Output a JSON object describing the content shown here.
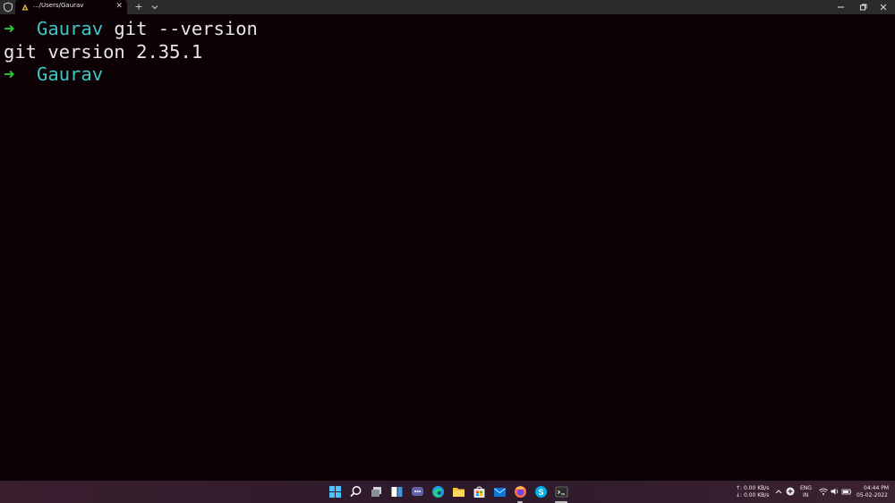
{
  "window": {
    "tab_title": ".../Users/Gaurav",
    "close_glyph": "✕",
    "new_tab_glyph": "+"
  },
  "terminal": {
    "lines": [
      {
        "arrow": "➜",
        "dir": "Gaurav",
        "cmd": " git --version"
      },
      {
        "output": "git version 2.35.1"
      },
      {
        "arrow": "➜",
        "dir": "Gaurav",
        "cmd": ""
      }
    ]
  },
  "taskbar": {
    "apps": [
      "windows-start",
      "search",
      "task-view",
      "widgets",
      "teams-chat",
      "edge",
      "file-explorer",
      "microsoft-store",
      "mail",
      "firefox",
      "skype",
      "terminal"
    ],
    "network_up": "↑: 0.00 KB/s",
    "network_down": "↓: 0.00 KB/s",
    "language_line1": "ENG",
    "language_line2": "IN",
    "time": "04:44 PM",
    "date": "05-02-2022"
  },
  "colors": {
    "terminal_bg": "#0c0205",
    "prompt_arrow": "#2ec43a",
    "prompt_dir": "#3ec6c6",
    "text": "#e6e6e6"
  }
}
